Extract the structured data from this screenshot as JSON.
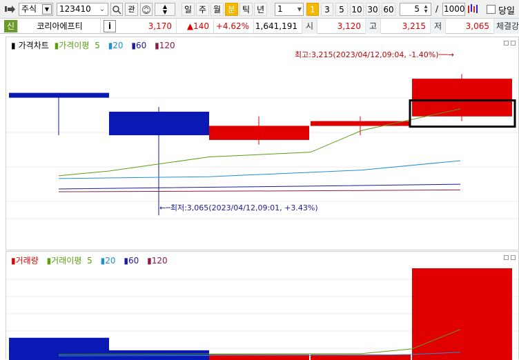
{
  "toolbar": {
    "market_select": "주식",
    "code_input": "123410",
    "btn_gwan": "관",
    "period_buttons": [
      "일",
      "주",
      "월",
      "분",
      "틱",
      "년"
    ],
    "active_period": "분",
    "interval_value": "1",
    "minute_buttons": [
      "1",
      "3",
      "5",
      "10",
      "30",
      "60"
    ],
    "active_minute": "1",
    "count_value": "5",
    "slash": "/",
    "total_value": "1000",
    "today_label": "당일"
  },
  "quote": {
    "badge": "신",
    "name": "코리아에프티",
    "info": "i",
    "price": "3,170",
    "change": "▲140",
    "rate": "+4.62%",
    "volume": "1,641,191",
    "open_label": "시",
    "open": "3,120",
    "high_label": "고",
    "high": "3,215",
    "low_label": "저",
    "low": "3,065",
    "cut_label": "체결강"
  },
  "price_panel": {
    "legend_title": "가격차트",
    "legend_ma": "가격이평",
    "ma_periods": [
      "5",
      "20",
      "60",
      "120"
    ],
    "high_annotation": "최고:3,215(2023/04/12,09:04, -1.40%)",
    "low_annotation": "최저:3,065(2023/04/12,09:01, +3.43%)"
  },
  "volume_panel": {
    "legend_title": "거래량",
    "legend_ma": "거래이평",
    "ma_periods": [
      "5",
      "20",
      "60",
      "120"
    ]
  },
  "colors": {
    "up": "#e00000",
    "down": "#0a18b4",
    "ma5": "#5a9e10",
    "ma20": "#2090d0",
    "ma60": "#1a1a9a",
    "ma120": "#8a1a4a",
    "active": "#f5b800",
    "highlight_box": "#000000"
  },
  "chart_data": {
    "type": "candlestick",
    "candles": [
      {
        "open": 3195,
        "high": 3195,
        "low": 3150,
        "close": 3190
      },
      {
        "open": 3175,
        "high": 3180,
        "low": 3065,
        "close": 3150
      },
      {
        "open": 3145,
        "high": 3170,
        "low": 3140,
        "close": 3160
      },
      {
        "open": 3160,
        "high": 3170,
        "low": 3150,
        "close": 3165
      },
      {
        "open": 3170,
        "high": 3215,
        "low": 3165,
        "close": 3210
      }
    ],
    "volume": [
      80,
      35,
      20,
      20,
      330
    ],
    "ma5": [
      3107,
      3112,
      3127,
      3132,
      3155,
      3178
    ],
    "ma20": [
      3104,
      3106,
      3113,
      3123
    ],
    "ma60": [
      3093,
      3096,
      3098
    ],
    "ma120": [
      3090,
      3091,
      3092
    ],
    "vol_ma5": [
      20,
      22,
      23,
      40,
      110
    ],
    "vol_ma20": [
      15,
      16,
      17,
      20,
      28
    ],
    "highlighted_candle": 4
  }
}
